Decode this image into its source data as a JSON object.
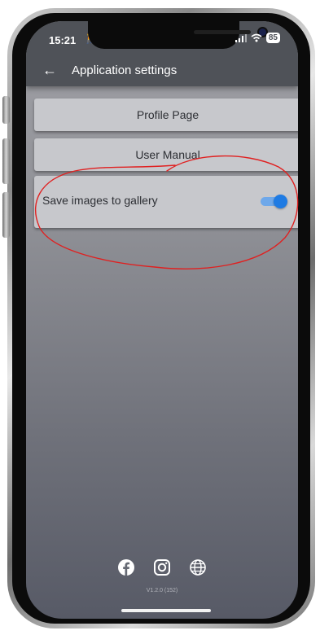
{
  "status_bar": {
    "time": "15:21",
    "battery": "85"
  },
  "header": {
    "title": "Application settings",
    "back_icon": "arrow-left-icon"
  },
  "menu": {
    "profile_label": "Profile Page",
    "manual_label": "User Manual"
  },
  "settings": {
    "save_images_label": "Save images to gallery",
    "save_images_enabled": true
  },
  "footer": {
    "social_icons": [
      "facebook-icon",
      "instagram-icon",
      "globe-icon"
    ],
    "version": "V1.2.0 (152)"
  },
  "colors": {
    "header_bg": "#4f5258",
    "button_bg": "#c7c8cc",
    "toggle_on": "#1f7be3",
    "annotation": "#e02020"
  }
}
